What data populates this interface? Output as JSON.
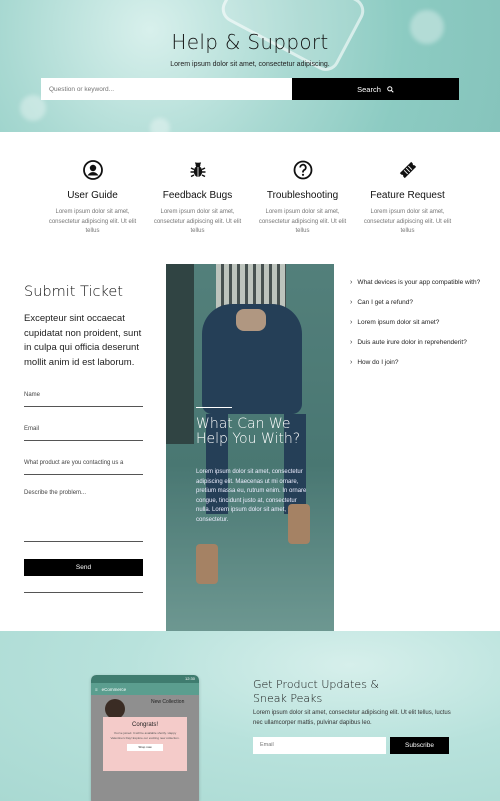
{
  "hero": {
    "title": "Help & Support",
    "subtitle": "Lorem ipsum dolor sit amet, consectetur adipiscing.",
    "search_placeholder": "Question or keyword...",
    "search_button": "Search"
  },
  "features": [
    {
      "icon": "user-circle-icon",
      "title": "User Guide",
      "desc": "Lorem ipsum dolor sit amet, consectetur adipiscing elit. Ut elit tellus"
    },
    {
      "icon": "bug-icon",
      "title": "Feedback Bugs",
      "desc": "Lorem ipsum dolor sit amet, consectetur adipiscing elit. Ut elit tellus"
    },
    {
      "icon": "question-circle-icon",
      "title": "Troubleshooting",
      "desc": "Lorem ipsum dolor sit amet, consectetur adipiscing elit. Ut elit tellus"
    },
    {
      "icon": "ticket-icon",
      "title": "Feature Request",
      "desc": "Lorem ipsum dolor sit amet, consectetur adipiscing elit. Ut elit tellus"
    }
  ],
  "ticket": {
    "title": "Submit Ticket",
    "intro": "Excepteur sint occaecat cupidatat non proident, sunt in culpa qui officia deserunt mollit anim id est laborum.",
    "name_placeholder": "Name",
    "email_placeholder": "Email",
    "product_placeholder": "What product are you contacting us a",
    "problem_placeholder": "Describe the problem...",
    "send_label": "Send"
  },
  "promo": {
    "title": "What Can We Help You With?",
    "text": "Lorem ipsum dolor sit amet, consectetur adipiscing elit. Maecenas ut mi ornare, pretium massa eu, rutrum enim. In ornare congue, tincidunt justo at, consectetur nulla. Lorem ipsum dolor sit amet, consectetur."
  },
  "faq": [
    "What devices is your app compatible with?",
    "Can I get a refund?",
    "Lorem ipsum dolor sit amet?",
    "Duis aute irure dolor in reprehenderit?",
    "How do I join?"
  ],
  "newsletter": {
    "title": "Get Product Updates & Sneak Peaks",
    "text": "Lorem ipsum dolor sit amet, consectetur adipiscing elit. Ut elit tellus, luctus nec ullamcorper mattis, pulvinar dapibus leo.",
    "email_placeholder": "Email",
    "subscribe_label": "Subscribe",
    "mock": {
      "time": "12:30",
      "app": "eCommerce",
      "collection": "New Collection",
      "popup_title": "Congrats!",
      "popup_text": "You've joined. It will be available shortly. Happy Valentine's Day! Explore our exciting new collection.",
      "popup_button": "Shop now"
    }
  },
  "colors": {
    "accent": "#000000",
    "hero_bg": "#9fd4cc",
    "popup": "#f4cbc9"
  }
}
